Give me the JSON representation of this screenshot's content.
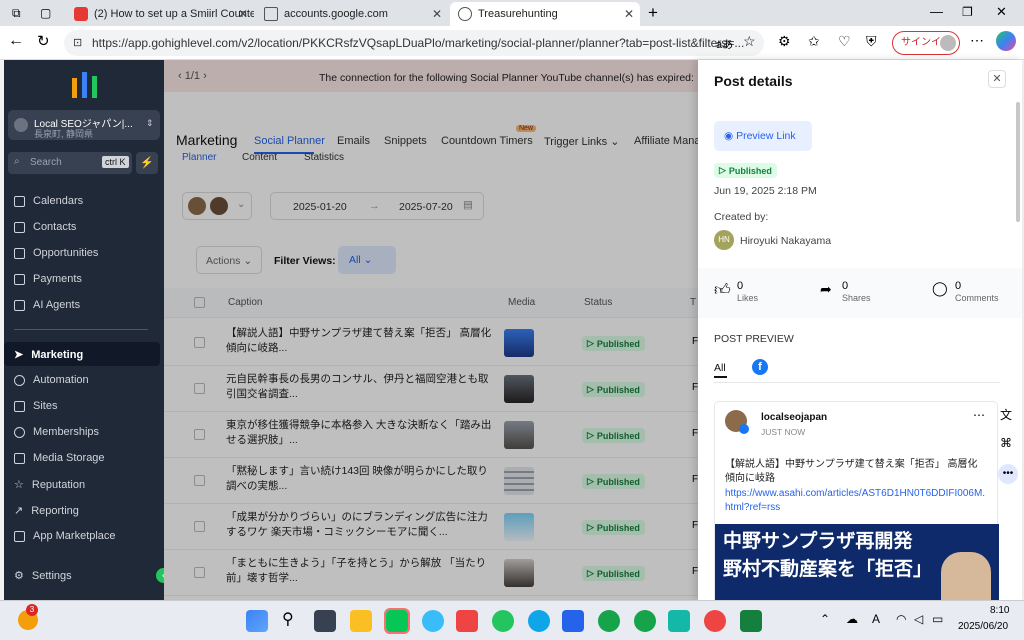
{
  "browser": {
    "tabs": [
      {
        "label": "(2) How to set up a Smiirl Counte"
      },
      {
        "label": "accounts.google.com"
      },
      {
        "label": "Treasurehunting"
      }
    ],
    "url": "https://app.gohighlevel.com/v2/location/PKKCRsfzVQsapLDuaPlo/marketing/social-planner/planner?tab=post-list&filters=...",
    "signin": "サインイン"
  },
  "sidebar": {
    "location_name": "Local SEOジャパン|...",
    "location_sub": "長泉町, 静岡県",
    "search_placeholder": "Search",
    "search_shortcut": "ctrl K",
    "items": [
      {
        "label": "Calendars"
      },
      {
        "label": "Contacts"
      },
      {
        "label": "Opportunities"
      },
      {
        "label": "Payments"
      },
      {
        "label": "AI Agents"
      },
      {
        "label": "Marketing"
      },
      {
        "label": "Automation"
      },
      {
        "label": "Sites"
      },
      {
        "label": "Memberships"
      },
      {
        "label": "Media Storage"
      },
      {
        "label": "Reputation"
      },
      {
        "label": "Reporting"
      },
      {
        "label": "App Marketplace"
      }
    ],
    "settings": "Settings"
  },
  "main": {
    "banner_pager": "1/1",
    "banner_text": "The connection for the following Social Planner YouTube channel(s) has expired: ロー",
    "title": "Marketing",
    "nav": [
      "Social Planner",
      "Emails",
      "Snippets",
      "Countdown Timers",
      "Trigger Links",
      "Affiliate Mana"
    ],
    "new_badge": "New",
    "subtabs": [
      "Planner",
      "Content",
      "Statistics"
    ],
    "date_from": "2025-01-20",
    "date_to": "2025-07-20",
    "actions": "Actions",
    "filter_views": "Filter Views:",
    "filter_all": "All",
    "columns": [
      "Caption",
      "Media",
      "Status",
      "T"
    ],
    "rows": [
      {
        "caption": "【解説人語】中野サンプラザ建て替え案「拒否」 高層化傾向に岐路...",
        "status": "Published",
        "t": "F"
      },
      {
        "caption": "元自民幹事長の長男のコンサル、伊丹と福岡空港とも取引国交省調査...",
        "status": "Published",
        "t": "F"
      },
      {
        "caption": "東京が移住獲得競争に本格参入 大きな決断なく「踏み出せる選択肢」...",
        "status": "Published",
        "t": "F"
      },
      {
        "caption": "「黙秘します」言い続け143回 映像が明らかにした取り調べの実態...",
        "status": "Published",
        "t": "F"
      },
      {
        "caption": "「成果が分かりづらい」のにブランディング広告に注力するワケ 楽天市場・コミックシーモアに聞く...",
        "status": "Published",
        "t": "F"
      },
      {
        "caption": "「まともに生きよう」「子を持とう」から解放 「当たり前」壊す哲学...",
        "status": "Published",
        "t": "F"
      }
    ]
  },
  "panel": {
    "title": "Post details",
    "preview_link": "Preview Link",
    "status": "Published",
    "date": "Jun 19, 2025 2:18 PM",
    "created_by_label": "Created by:",
    "creator_initials": "HN",
    "creator_name": "Hiroyuki Nakayama",
    "likes": "0",
    "likes_label": "Likes",
    "shares": "0",
    "shares_label": "Shares",
    "comments": "0",
    "comments_label": "Comments",
    "preview_heading": "POST PREVIEW",
    "preview_tab_all": "All",
    "post_author": "localseojapan",
    "post_time": "JUST NOW",
    "post_text": "【解説人語】中野サンプラザ建て替え案「拒否」 高層化傾向に岐路",
    "post_link": "https://www.asahi.com/articles/AST6D1HN0T6DDIFI006M.html?ref=rss",
    "image_line1": "中野サンプラザ再開発",
    "image_line2": "野村不動産案を「拒否」"
  },
  "taskbar": {
    "time": "8:10",
    "date": "2025/06/20",
    "notif": "3"
  },
  "colors": {
    "accent": "#2563eb",
    "sidebar": "#1f2937",
    "published": "#15803d"
  }
}
